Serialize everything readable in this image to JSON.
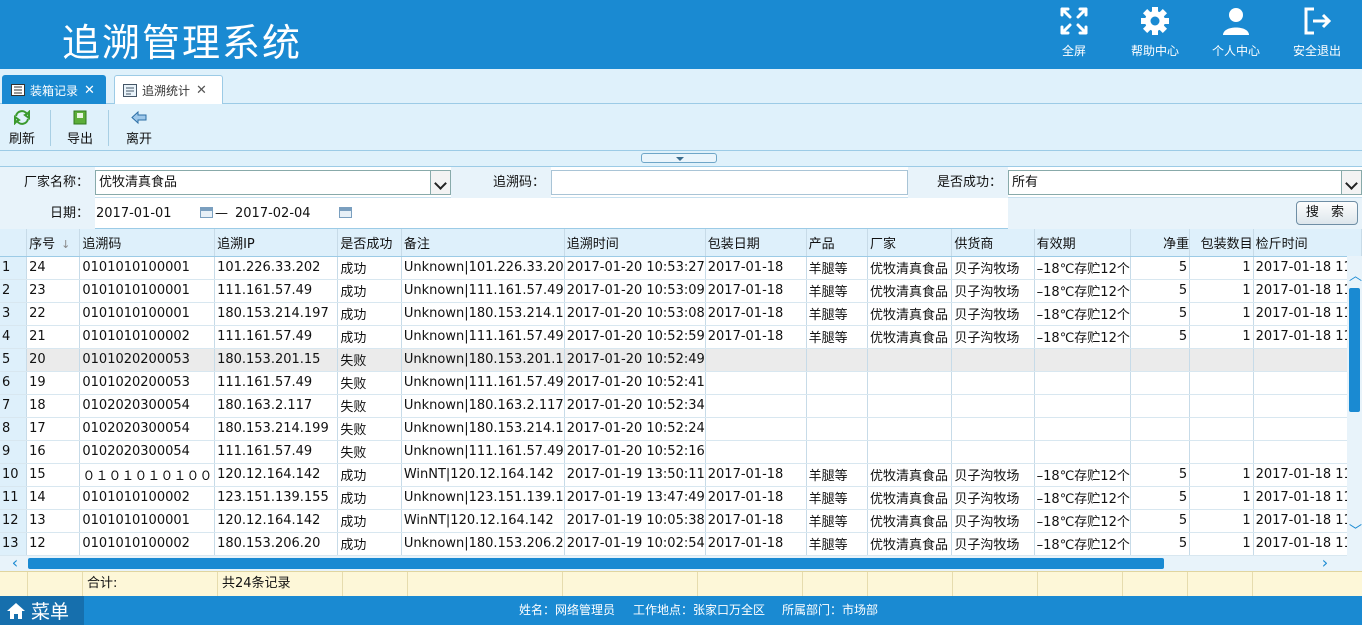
{
  "header": {
    "title": "追溯管理系统",
    "buttons": [
      {
        "label": "全屏",
        "icon": "fullscreen-icon"
      },
      {
        "label": "帮助中心",
        "icon": "gear-icon"
      },
      {
        "label": "个人中心",
        "icon": "user-icon"
      },
      {
        "label": "安全退出",
        "icon": "logout-icon"
      }
    ]
  },
  "tabs": [
    {
      "label": "装箱记录",
      "active": true
    },
    {
      "label": "追溯统计",
      "active": false
    }
  ],
  "toolbar": {
    "refresh": "刷新",
    "export": "导出",
    "leave": "离开"
  },
  "filter": {
    "vendor_label": "厂家名称：",
    "vendor_value": "优牧清真食品",
    "trace_code_label": "追溯码：",
    "trace_code_value": "",
    "success_label": "是否成功：",
    "success_value": "所有",
    "date_label": "日期：",
    "date_from": "2017-01-01",
    "date_sep": "—",
    "date_to": "2017-02-04",
    "search_button": "搜 索"
  },
  "table": {
    "columns": [
      "序号",
      "追溯码",
      "追溯IP",
      "是否成功",
      "备注",
      "追溯时间",
      "包装日期",
      "产品",
      "厂家",
      "供货商",
      "有效期",
      "净重",
      "包装数目",
      "检斤时间"
    ],
    "rows": [
      [
        "1",
        "24",
        "0101010100001",
        "101.226.33.202",
        "成功",
        "Unknown|101.226.33.20",
        "2017-01-20 10:53:27",
        "2017-01-18",
        "羊腿等",
        "优牧清真食品",
        "贝子沟牧场",
        "–18℃存贮12个",
        "5",
        "1",
        "2017-01-18 11"
      ],
      [
        "2",
        "23",
        "0101010100001",
        "111.161.57.49",
        "成功",
        "Unknown|111.161.57.49",
        "2017-01-20 10:53:09",
        "2017-01-18",
        "羊腿等",
        "优牧清真食品",
        "贝子沟牧场",
        "–18℃存贮12个",
        "5",
        "1",
        "2017-01-18 11"
      ],
      [
        "3",
        "22",
        "0101010100001",
        "180.153.214.197",
        "成功",
        "Unknown|180.153.214.1",
        "2017-01-20 10:53:08",
        "2017-01-18",
        "羊腿等",
        "优牧清真食品",
        "贝子沟牧场",
        "–18℃存贮12个",
        "5",
        "1",
        "2017-01-18 11"
      ],
      [
        "4",
        "21",
        "0101010100002",
        "111.161.57.49",
        "成功",
        "Unknown|111.161.57.49",
        "2017-01-20 10:52:59",
        "2017-01-18",
        "羊腿等",
        "优牧清真食品",
        "贝子沟牧场",
        "–18℃存贮12个",
        "5",
        "1",
        "2017-01-18 11"
      ],
      [
        "5",
        "20",
        "0101020200053",
        "180.153.201.15",
        "失败",
        "Unknown|180.153.201.1",
        "2017-01-20 10:52:49",
        "",
        "",
        "",
        "",
        "",
        "",
        "",
        ""
      ],
      [
        "6",
        "19",
        "0101020200053",
        "111.161.57.49",
        "失败",
        "Unknown|111.161.57.49",
        "2017-01-20 10:52:41",
        "",
        "",
        "",
        "",
        "",
        "",
        "",
        ""
      ],
      [
        "7",
        "18",
        "0102020300054",
        "180.163.2.117",
        "失败",
        "Unknown|180.163.2.117",
        "2017-01-20 10:52:34",
        "",
        "",
        "",
        "",
        "",
        "",
        "",
        ""
      ],
      [
        "8",
        "17",
        "0102020300054",
        "180.153.214.199",
        "失败",
        "Unknown|180.153.214.1",
        "2017-01-20 10:52:24",
        "",
        "",
        "",
        "",
        "",
        "",
        "",
        ""
      ],
      [
        "9",
        "16",
        "0102020300054",
        "111.161.57.49",
        "失败",
        "Unknown|111.161.57.49",
        "2017-01-20 10:52:16",
        "",
        "",
        "",
        "",
        "",
        "",
        "",
        ""
      ],
      [
        "10",
        "15",
        "０１０１０１０１００",
        "120.12.164.142",
        "成功",
        "WinNT|120.12.164.142",
        "2017-01-19 13:50:11",
        "2017-01-18",
        "羊腿等",
        "优牧清真食品",
        "贝子沟牧场",
        "–18℃存贮12个",
        "5",
        "1",
        "2017-01-18 11"
      ],
      [
        "11",
        "14",
        "0101010100002",
        "123.151.139.155",
        "成功",
        "Unknown|123.151.139.1",
        "2017-01-19 13:47:49",
        "2017-01-18",
        "羊腿等",
        "优牧清真食品",
        "贝子沟牧场",
        "–18℃存贮12个",
        "5",
        "1",
        "2017-01-18 11"
      ],
      [
        "12",
        "13",
        "0101010100001",
        "120.12.164.142",
        "成功",
        "WinNT|120.12.164.142",
        "2017-01-19 10:05:38",
        "2017-01-18",
        "羊腿等",
        "优牧清真食品",
        "贝子沟牧场",
        "–18℃存贮12个",
        "5",
        "1",
        "2017-01-18 11"
      ],
      [
        "13",
        "12",
        "0101010100002",
        "180.153.206.20",
        "成功",
        "Unknown|180.153.206.2",
        "2017-01-19 10:02:54",
        "2017-01-18",
        "羊腿等",
        "优牧清真食品",
        "贝子沟牧场",
        "–18℃存贮12个",
        "5",
        "1",
        "2017-01-18 11"
      ]
    ],
    "selected_row": 5
  },
  "summary": {
    "total_label": "合计:",
    "total_value": "共24条记录"
  },
  "status": {
    "menu": "菜单",
    "name": "姓名：网络管理员",
    "location": "工作地点：张家口万全区",
    "department": "所属部门：市场部"
  },
  "colors": {
    "brand": "#1a8ad2",
    "panel": "#dff1fb",
    "summary": "#fdf7d8"
  }
}
